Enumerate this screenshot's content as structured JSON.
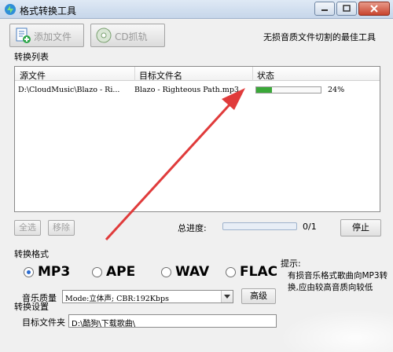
{
  "window": {
    "title": "格式转换工具",
    "tagline": "无损音质文件切割的最佳工具"
  },
  "toolbar": {
    "add_file_label": "添加文件",
    "cd_grab_label": "CD抓轨"
  },
  "file_list": {
    "section_label": "转换列表",
    "columns": [
      "源文件",
      "目标文件名",
      "状态"
    ],
    "rows": [
      {
        "source": "D:\\CloudMusic\\Blazo - Ri...",
        "target": "Blazo - Righteous Path.mp3",
        "progress_percent": 24,
        "progress_text": "24%"
      }
    ]
  },
  "controls": {
    "select_all_label": "全选",
    "remove_label": "移除",
    "overall_progress_label": "总进度:",
    "overall_progress_value": 0,
    "overall_progress_text": "0/1",
    "stop_label": "停止"
  },
  "format": {
    "section_label": "转换格式",
    "options": [
      {
        "label": "MP3",
        "selected": true
      },
      {
        "label": "APE",
        "selected": false
      },
      {
        "label": "WAV",
        "selected": false
      },
      {
        "label": "FLAC",
        "selected": false
      }
    ],
    "quality_label": "音乐质量",
    "quality_value": "Mode:立体声; CBR:192Kbps",
    "advanced_label": "高级"
  },
  "hint": {
    "title": "提示:",
    "body": "有损音乐格式歌曲向MP3转换,应由较高音质向较低"
  },
  "settings": {
    "section_label": "转换设置",
    "folder_label": "目标文件夹",
    "folder_value": "D:\\酷狗\\下载歌曲\\"
  },
  "colors": {
    "progress_fill": "#3aa838",
    "annotation_arrow": "#e03b3b"
  }
}
